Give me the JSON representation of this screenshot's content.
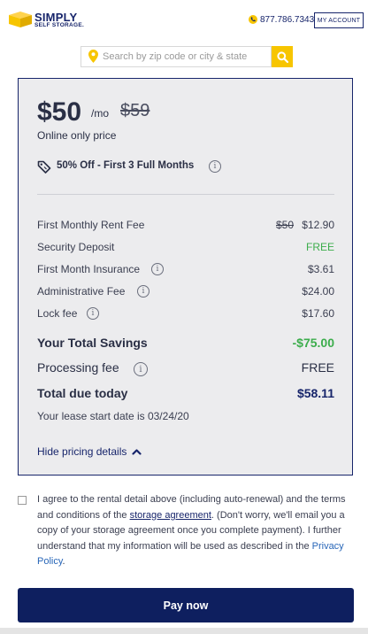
{
  "header": {
    "logo_line1": "SIMPLY",
    "logo_line2": "SELF STORAGE.",
    "phone": "877.786.7343",
    "account_label": "MY ACCOUNT"
  },
  "search": {
    "placeholder": "Search by zip code or city & state"
  },
  "pricing": {
    "price": "$50",
    "per": "/mo",
    "old_price": "$59",
    "online_only": "Online only price",
    "promo": "50% Off - First 3 Full Months",
    "rows": [
      {
        "label": "First Monthly Rent Fee",
        "old_value": "$50",
        "value": "$12.90"
      },
      {
        "label": "Security Deposit",
        "value": "FREE"
      },
      {
        "label": "First Month Insurance",
        "value": "$3.61"
      },
      {
        "label": "Administrative Fee",
        "value": "$24.00"
      },
      {
        "label": "Lock fee",
        "value": "$17.60"
      }
    ],
    "savings_label": "Your Total Savings",
    "savings_value": "-$75.00",
    "processing_label": "Processing fee",
    "processing_value": "FREE",
    "total_label": "Total due today",
    "total_value": "$58.11",
    "lease_start": "Your lease start date is 03/24/20",
    "hide_label": "Hide pricing details"
  },
  "agreement": {
    "text_1": "I agree to the rental detail above (including auto-renewal) and the terms and conditions of the ",
    "link_1": "storage agreement",
    "text_2": ". (Don't worry, we'll email you a copy of your storage agreement once you complete payment). I further understand that my information will be used as described in the ",
    "link_2": "Privacy Policy",
    "text_3": "."
  },
  "pay_label": "Pay now",
  "colors": {
    "brand_navy": "#17256b",
    "button_navy": "#0e1f5f",
    "accent_yellow": "#f7c500",
    "free_green": "#3cad4c"
  },
  "icons": {
    "logo": "simply-cube-logo",
    "phone": "phone-icon",
    "search_pin": "map-pin-icon",
    "search": "search-icon",
    "promo": "tag-icon",
    "info": "info-icon",
    "hide": "chevron-up-icon"
  }
}
